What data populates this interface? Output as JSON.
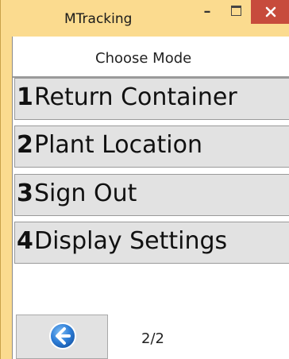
{
  "window": {
    "title": "MTracking",
    "minimize_glyph": "–"
  },
  "header": {
    "title": "Choose Mode"
  },
  "modes": [
    {
      "number": "1",
      "label": "Return Container"
    },
    {
      "number": "2",
      "label": "Plant Location"
    },
    {
      "number": "3",
      "label": "Sign Out"
    },
    {
      "number": "4",
      "label": "Display Settings"
    }
  ],
  "footer": {
    "back_icon": "back-arrow-icon",
    "page_indicator": "2/2"
  },
  "colors": {
    "title_bar": "#fbdb8f",
    "close_button": "#c74b3c",
    "button_face": "#e2e2e2",
    "back_icon_blue": "#2f7fd8"
  }
}
